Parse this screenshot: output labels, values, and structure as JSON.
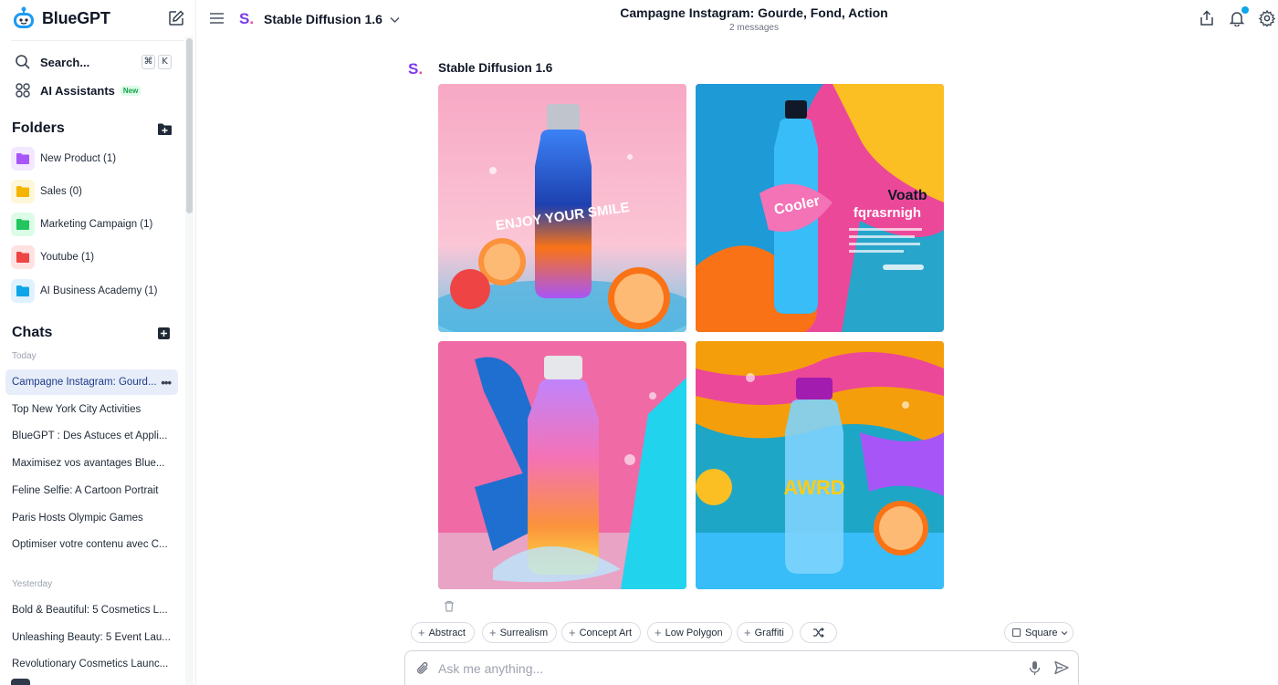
{
  "app": {
    "name": "BlueGPT"
  },
  "sidebar": {
    "search": {
      "label": "Search...",
      "kbd_mod": "⌘",
      "kbd_key": "K"
    },
    "assistants": {
      "label": "AI Assistants",
      "badge": "New"
    },
    "folders_title": "Folders",
    "folders": [
      {
        "label": "New Product (1)",
        "color": "#a855f7",
        "bg": "#f3e8ff"
      },
      {
        "label": "Sales (0)",
        "color": "#f5b400",
        "bg": "#fef6d8"
      },
      {
        "label": "Marketing Campaign (1)",
        "color": "#22c55e",
        "bg": "#dcfce7"
      },
      {
        "label": "Youtube (1)",
        "color": "#ef4444",
        "bg": "#fee2e2"
      },
      {
        "label": "AI Business Academy (1)",
        "color": "#0ea5e9",
        "bg": "#e0f2fe"
      }
    ],
    "chats_title": "Chats",
    "groups": [
      {
        "label": "Today",
        "items": [
          "Campagne Instagram: Gourd...",
          "Top New York City Activities",
          "BlueGPT : Des Astuces et Appli...",
          "Maximisez vos avantages Blue...",
          "Feline Selfie: A Cartoon Portrait",
          "Paris Hosts Olympic Games",
          "Optimiser votre contenu avec C..."
        ]
      },
      {
        "label": "Yesterday",
        "items": [
          "Bold & Beautiful: 5 Cosmetics L...",
          "Unleashing Beauty: 5 Event Lau...",
          "Revolutionary Cosmetics Launc..."
        ]
      }
    ]
  },
  "header": {
    "model": "Stable Diffusion 1.6",
    "model_logo": "S",
    "model_logo_dot": ".",
    "title": "Campagne Instagram: Gourde, Fond, Action",
    "subtitle": "2 messages"
  },
  "message": {
    "author": "Stable Diffusion 1.6",
    "images": [
      {
        "alt": "Rainbow water bottle with orange splash on pink background"
      },
      {
        "alt": "Blue bottle with colorful paint splash and text"
      },
      {
        "alt": "Gradient bottle with water splash on pink background"
      },
      {
        "alt": "Clear water bottle with orange on colorful background"
      }
    ],
    "image_texts": {
      "img1": "ENJOY YOUR SMILE",
      "img2_a": "Voatb",
      "img2_b": "fqrasrnigh",
      "img3": "",
      "img4": "AWRD"
    }
  },
  "styles": [
    "Abstract",
    "Surrealism",
    "Concept Art",
    "Low Polygon",
    "Graffiti"
  ],
  "aspect": "Square",
  "input": {
    "placeholder": "Ask me anything..."
  },
  "colors": {
    "accent": "#1e3a8a",
    "active_bg": "#e8eef9",
    "notification": "#0ea5e9"
  }
}
